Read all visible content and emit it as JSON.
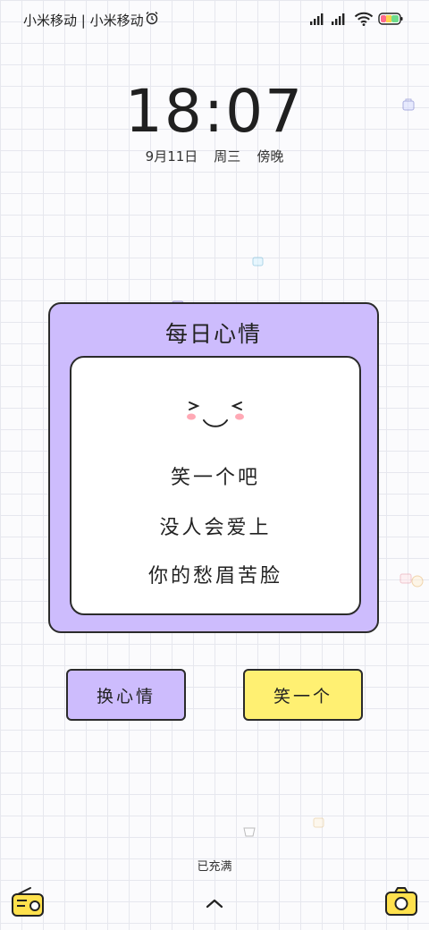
{
  "status_bar": {
    "carrier": "小米移动 | 小米移动",
    "alarm_icon": "alarm-icon",
    "signal_icons": [
      "signal-icon",
      "signal-icon"
    ],
    "wifi_icon": "wifi-icon",
    "battery_icon": "battery-icon"
  },
  "lockscreen": {
    "time": "18:07",
    "date": "9月11日",
    "weekday": "周三",
    "period": "傍晚"
  },
  "card": {
    "title": "每日心情",
    "face": ">‿<",
    "lines": [
      "笑一个吧",
      "没人会爱上",
      "你的愁眉苦脸"
    ]
  },
  "buttons": {
    "change": "换心情",
    "smile": "笑一个"
  },
  "bottom": {
    "charge_status": "已充满"
  },
  "colors": {
    "card_purple": "#cdbcfd",
    "button_yellow": "#fff072",
    "outline": "#2b2b2b",
    "battery_green": "#6fdc8c",
    "battery_red": "#ff6b8b"
  }
}
